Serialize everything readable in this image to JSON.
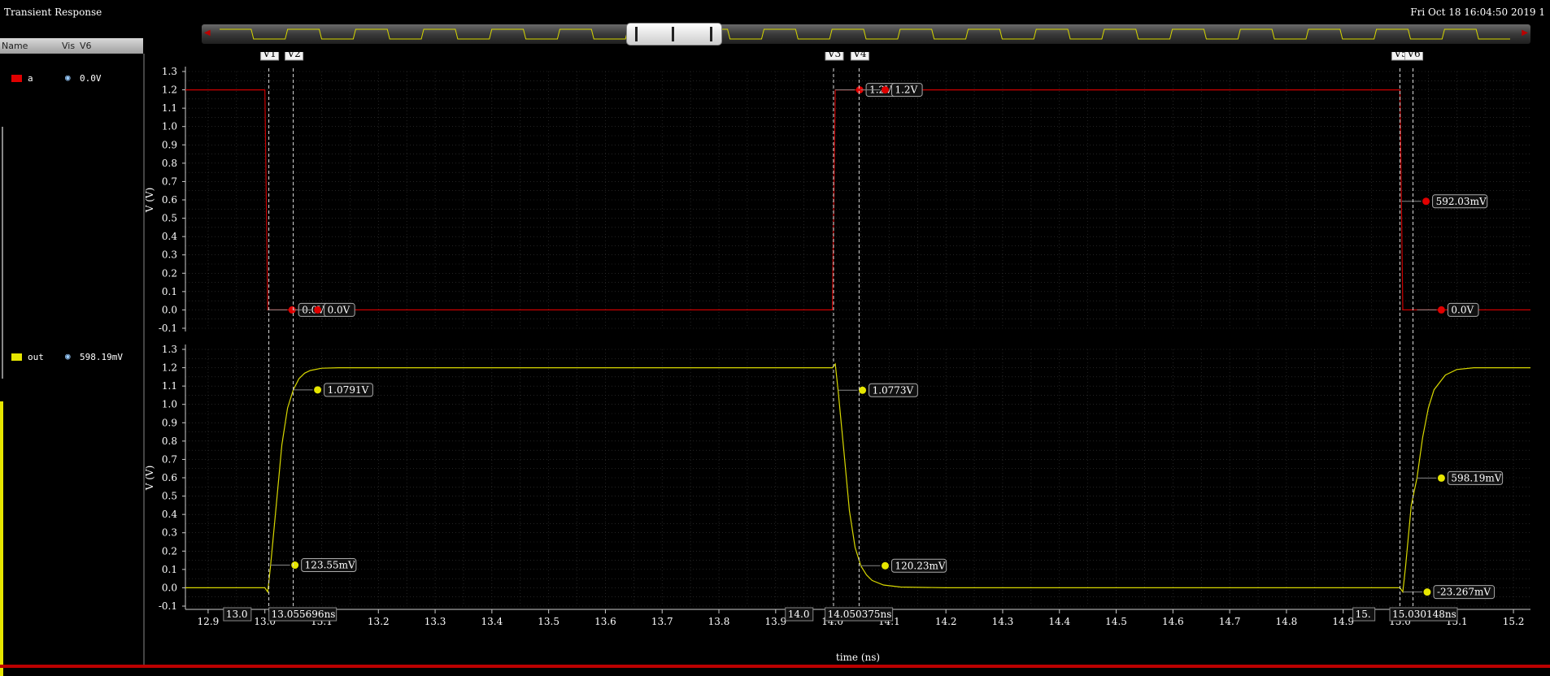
{
  "window": {
    "title": "Transient Response",
    "datestamp": "Fri Oct 18 16:04:50 2019  1"
  },
  "legend": {
    "header": {
      "name": "Name",
      "vis": "Vis",
      "v6": "V6"
    },
    "entries": [
      {
        "name": "a",
        "value": "0.0V",
        "color": "#e00000"
      },
      {
        "name": "out",
        "value": "598.19mV",
        "color": "#e6e600"
      }
    ]
  },
  "colors": {
    "a": "#cc0000",
    "out": "#d8d800",
    "grid": "#3a3a3a",
    "cursor": "#dddddd"
  },
  "chart_data": {
    "type": "line",
    "xlabel": "time (ns)",
    "xlim": [
      12.86,
      15.23
    ],
    "x_ticks": [
      "12.9",
      "13.0",
      "13.1",
      "13.2",
      "13.3",
      "13.4",
      "13.5",
      "13.6",
      "13.7",
      "13.8",
      "13.9",
      "14.0",
      "14.1",
      "14.2",
      "14.3",
      "14.4",
      "14.5",
      "14.6",
      "14.7",
      "14.8",
      "14.9",
      "15.0",
      "15.1",
      "15.2"
    ],
    "grid": true,
    "panels": [
      {
        "series": "a",
        "ylabel": "V (V)",
        "ylim": [
          -0.1,
          1.3
        ],
        "y_ticks": [
          "1.3",
          "1.2",
          "1.1",
          "1.0",
          "0.9",
          "0.8",
          "0.7",
          "0.6",
          "0.5",
          "0.4",
          "0.3",
          "0.2",
          "0.1",
          "0.0",
          "-0.1"
        ],
        "x": [
          12.86,
          13.0,
          13.005,
          14.0,
          14.005,
          15.0,
          15.005,
          15.23
        ],
        "y": [
          1.2,
          1.2,
          0.0,
          0.0,
          1.2,
          1.2,
          0.0,
          0.0
        ],
        "markers": [
          {
            "x": 13.005,
            "y": 0.0,
            "label": "0.0V"
          },
          {
            "x": 13.05,
            "y": 0.0,
            "label": "0.0V"
          },
          {
            "x": 14.005,
            "y": 1.2,
            "label": "1.2V"
          },
          {
            "x": 14.05,
            "y": 1.2,
            "label": "1.2V"
          },
          {
            "x": 15.003,
            "y": 0.592,
            "label": "592.03mV"
          },
          {
            "x": 15.03,
            "y": 0.0,
            "label": "0.0V"
          }
        ]
      },
      {
        "series": "out",
        "ylabel": "V (V)",
        "ylim": [
          -0.1,
          1.3
        ],
        "y_ticks": [
          "1.3",
          "1.2",
          "1.1",
          "1.0",
          "0.9",
          "0.8",
          "0.7",
          "0.6",
          "0.5",
          "0.4",
          "0.3",
          "0.2",
          "0.1",
          "0.0",
          "-0.1"
        ],
        "x": [
          12.86,
          13.0,
          13.005,
          13.01,
          13.02,
          13.03,
          13.04,
          13.05,
          13.06,
          13.07,
          13.08,
          13.1,
          13.13,
          13.2,
          14.0,
          14.005,
          14.01,
          14.02,
          14.03,
          14.04,
          14.05,
          14.06,
          14.07,
          14.09,
          14.12,
          14.2,
          15.0,
          15.005,
          15.01,
          15.02,
          15.03,
          15.04,
          15.05,
          15.06,
          15.08,
          15.1,
          15.13,
          15.23
        ],
        "y": [
          0.0,
          0.0,
          -0.023,
          0.12,
          0.45,
          0.78,
          0.98,
          1.079,
          1.14,
          1.17,
          1.185,
          1.197,
          1.2,
          1.2,
          1.2,
          1.22,
          1.077,
          0.75,
          0.42,
          0.22,
          0.12,
          0.07,
          0.04,
          0.015,
          0.004,
          0.0,
          0.0,
          -0.023,
          0.12,
          0.45,
          0.598,
          0.82,
          0.98,
          1.08,
          1.16,
          1.19,
          1.2,
          1.2
        ],
        "markers": [
          {
            "x": 13.01,
            "y": 0.12355,
            "label": "123.55mV"
          },
          {
            "x": 13.05,
            "y": 1.0791,
            "label": "1.0791V"
          },
          {
            "x": 14.01,
            "y": 1.0773,
            "label": "1.0773V"
          },
          {
            "x": 14.05,
            "y": 0.12023,
            "label": "120.23mV"
          },
          {
            "x": 15.03,
            "y": 0.59819,
            "label": "598.19mV"
          },
          {
            "x": 15.005,
            "y": -0.023267,
            "label": "-23.267mV"
          }
        ]
      }
    ],
    "cursors": [
      {
        "name": "V1",
        "x": 13.007
      },
      {
        "name": "V2",
        "x": 13.05
      },
      {
        "name": "V3",
        "x": 14.002
      },
      {
        "name": "V4",
        "x": 14.047
      },
      {
        "name": "V5",
        "x": 15.0,
        "label": "V5"
      },
      {
        "name": "V6",
        "x": 15.023
      }
    ],
    "cursor_time_labels": [
      {
        "text": "13.0",
        "x": 12.93
      },
      {
        "text": "13.055696ns",
        "x": 13.01
      },
      {
        "text": "14.0",
        "x": 13.92
      },
      {
        "text": "14.050375ns",
        "x": 13.99
      },
      {
        "text": "15.",
        "x": 14.92
      },
      {
        "text": "15.030148ns",
        "x": 14.985
      }
    ],
    "overview_pulses": 38
  }
}
